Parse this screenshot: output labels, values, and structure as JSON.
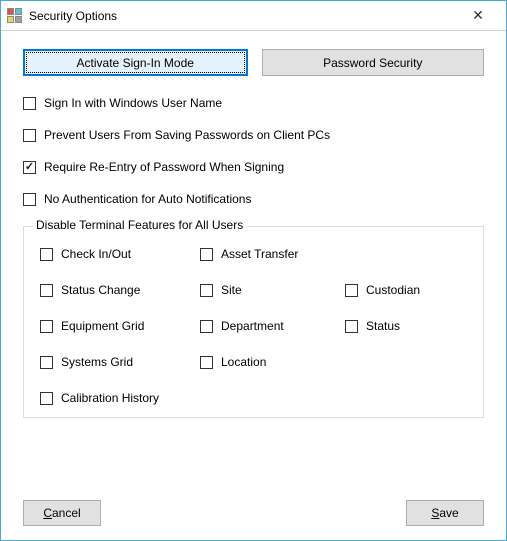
{
  "window": {
    "title": "Security Options"
  },
  "tabs": {
    "activate": "Activate Sign-In Mode",
    "password": "Password Security"
  },
  "options": {
    "signin_windows": {
      "label": "Sign In with Windows User Name",
      "checked": false
    },
    "prevent_save": {
      "label": "Prevent Users From Saving Passwords on Client PCs",
      "checked": false
    },
    "require_reentry": {
      "label": "Require Re-Entry of Password When Signing",
      "checked": true
    },
    "no_auth_auto": {
      "label": "No Authentication for Auto Notifications",
      "checked": false
    }
  },
  "disable_group": {
    "legend": "Disable Terminal Features for All Users",
    "items": {
      "check_in_out": {
        "label": "Check In/Out",
        "checked": false
      },
      "asset_transfer": {
        "label": "Asset Transfer",
        "checked": false
      },
      "status_change": {
        "label": "Status Change",
        "checked": false
      },
      "site": {
        "label": "Site",
        "checked": false
      },
      "custodian": {
        "label": "Custodian",
        "checked": false
      },
      "equipment_grid": {
        "label": "Equipment Grid",
        "checked": false
      },
      "department": {
        "label": "Department",
        "checked": false
      },
      "status": {
        "label": "Status",
        "checked": false
      },
      "systems_grid": {
        "label": "Systems Grid",
        "checked": false
      },
      "location": {
        "label": "Location",
        "checked": false
      },
      "calibration_history": {
        "label": "Calibration History",
        "checked": false
      }
    }
  },
  "buttons": {
    "cancel": "Cancel",
    "save": "Save"
  }
}
